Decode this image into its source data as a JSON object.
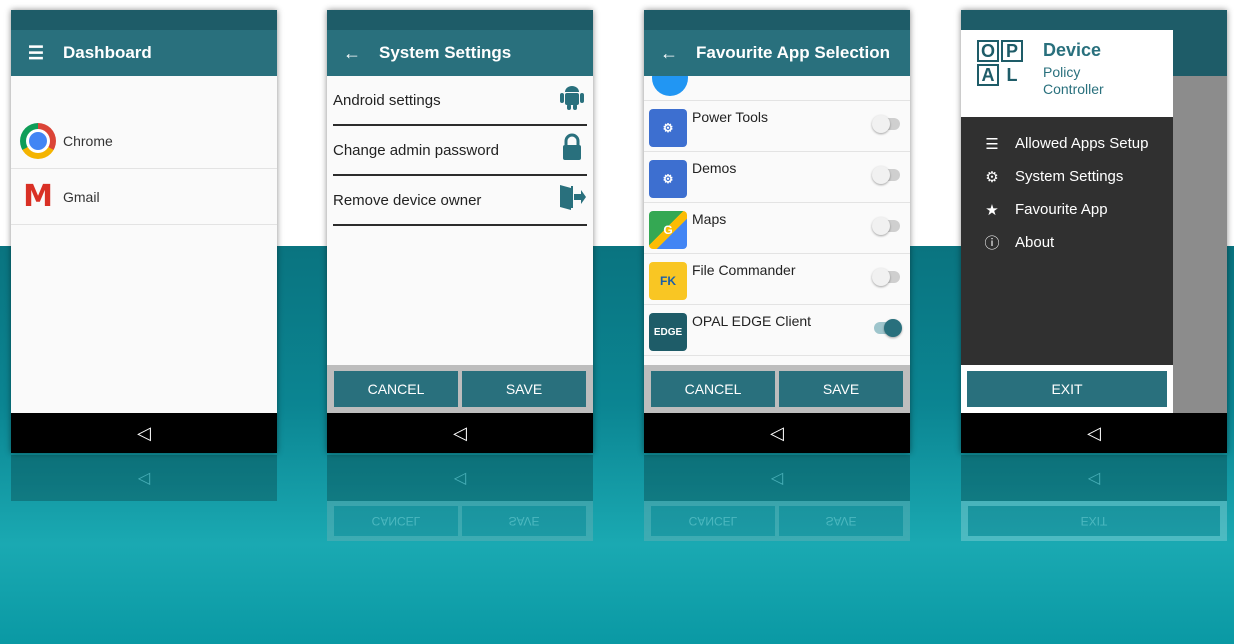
{
  "screens": {
    "dashboard": {
      "title": "Dashboard",
      "menu_icon": "hamburger-menu-icon",
      "apps": [
        {
          "label": "Chrome",
          "icon": "chrome-icon"
        },
        {
          "label": "Gmail",
          "icon": "gmail-icon"
        }
      ]
    },
    "system_settings": {
      "title": "System Settings",
      "back_icon": "back-arrow-icon",
      "items": [
        {
          "label": "Android settings",
          "icon": "android-icon"
        },
        {
          "label": "Change admin password",
          "icon": "lock-icon"
        },
        {
          "label": "Remove device owner",
          "icon": "exit-door-icon"
        }
      ],
      "cancel": "CANCEL",
      "save": "SAVE"
    },
    "favourite": {
      "title": "Favourite App Selection",
      "apps": [
        {
          "label": "Power Tools",
          "icon": "settings-folder-icon",
          "enabled": false
        },
        {
          "label": "Demos",
          "icon": "settings-folder-icon",
          "enabled": false
        },
        {
          "label": "Maps",
          "icon": "maps-icon",
          "enabled": false
        },
        {
          "label": "File Commander",
          "icon": "file-commander-icon",
          "enabled": false
        },
        {
          "label": "OPAL EDGE Client",
          "icon": "edge-client-icon",
          "enabled": true
        }
      ],
      "cancel": "CANCEL",
      "save": "SAVE"
    },
    "drawer": {
      "logo_letters": [
        "O",
        "P",
        "A",
        "L"
      ],
      "title": "Device",
      "subtitle_line1": "Policy",
      "subtitle_line2": "Controller",
      "menu": [
        {
          "label": "Allowed Apps Setup",
          "icon": "list-icon"
        },
        {
          "label": "System Settings",
          "icon": "gear-icon"
        },
        {
          "label": "Favourite App",
          "icon": "star-icon"
        },
        {
          "label": "About",
          "icon": "info-icon"
        }
      ],
      "exit": "EXIT"
    }
  },
  "colors": {
    "primary": "#29707d",
    "status_bar": "#1e5c68",
    "drawer_bg": "#303030",
    "button_bar": "#bdbdbd"
  }
}
